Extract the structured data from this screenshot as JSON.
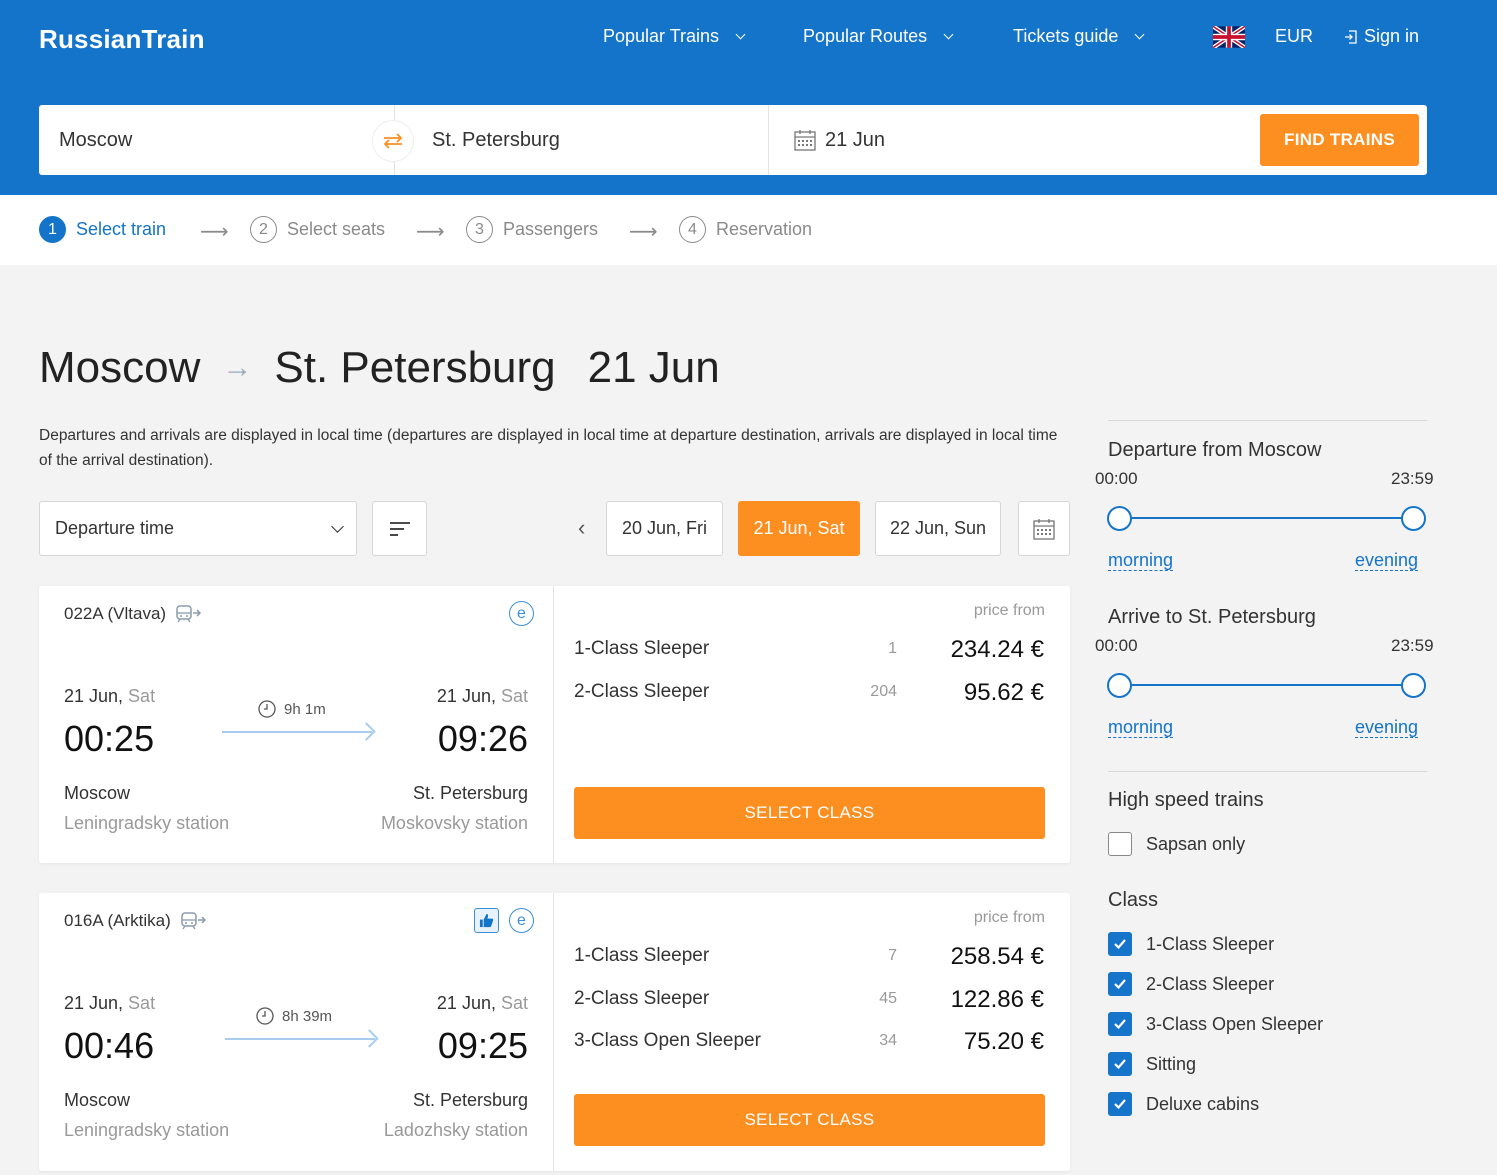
{
  "header": {
    "logo": "RussianTrain",
    "nav": [
      "Popular Trains",
      "Popular Routes",
      "Tickets guide"
    ],
    "currency": "EUR",
    "signin": "Sign in"
  },
  "search": {
    "from": "Moscow",
    "to": "St. Petersburg",
    "date": "21 Jun",
    "button": "FIND TRAINS"
  },
  "steps": [
    {
      "num": "1",
      "label": "Select train"
    },
    {
      "num": "2",
      "label": "Select seats"
    },
    {
      "num": "3",
      "label": "Passengers"
    },
    {
      "num": "4",
      "label": "Reservation"
    }
  ],
  "title": {
    "from": "Moscow",
    "to": "St. Petersburg",
    "date": "21 Jun"
  },
  "notice": "Departures and arrivals are displayed in local time (departures are displayed in local time at departure destination, arrivals are displayed in local time of the arrival destination).",
  "sort": {
    "label": "Departure time"
  },
  "dates": [
    "20 Jun, Fri",
    "21 Jun, Sat",
    "22 Jun, Sun"
  ],
  "trains": [
    {
      "name": "022A (Vltava)",
      "dep_date": "21 Jun,",
      "dep_wd": " Sat",
      "dep_time": "00:25",
      "arr_date": "21 Jun,",
      "arr_wd": " Sat",
      "arr_time": "09:26",
      "duration": "9h 1m",
      "from_city": "Moscow",
      "from_station": "Leningradsky station",
      "to_city": "St. Petersburg",
      "to_station": "Moskovsky station",
      "price_from": "price from",
      "classes": [
        {
          "name": "1-Class Sleeper",
          "seats": "1",
          "price": "234.24 €"
        },
        {
          "name": "2-Class Sleeper",
          "seats": "204",
          "price": "95.62 €"
        }
      ],
      "button": "SELECT CLASS"
    },
    {
      "name": "016A (Arktika)",
      "dep_date": "21 Jun,",
      "dep_wd": " Sat",
      "dep_time": "00:46",
      "arr_date": "21 Jun,",
      "arr_wd": " Sat",
      "arr_time": "09:25",
      "duration": "8h 39m",
      "from_city": "Moscow",
      "from_station": "Leningradsky station",
      "to_city": "St. Petersburg",
      "to_station": "Ladozhsky station",
      "price_from": "price from",
      "classes": [
        {
          "name": "1-Class Sleeper",
          "seats": "7",
          "price": "258.54 €"
        },
        {
          "name": "2-Class Sleeper",
          "seats": "45",
          "price": "122.86 €"
        },
        {
          "name": "3-Class Open Sleeper",
          "seats": "34",
          "price": "75.20 €"
        }
      ],
      "button": "SELECT CLASS"
    }
  ],
  "filters": {
    "departure": {
      "title": "Departure from Moscow",
      "min": "00:00",
      "max": "23:59",
      "morning": "morning",
      "evening": "evening"
    },
    "arrival": {
      "title": "Arrive to St. Petersburg",
      "min": "00:00",
      "max": "23:59",
      "morning": "morning",
      "evening": "evening"
    },
    "highspeed": {
      "title": "High speed trains",
      "option": "Sapsan only"
    },
    "class": {
      "title": "Class",
      "options": [
        "1-Class Sleeper",
        "2-Class Sleeper",
        "3-Class Open Sleeper",
        "Sitting",
        "Deluxe cabins"
      ]
    }
  },
  "colors": {
    "brand": "#1474c9",
    "accent": "#fd8f21"
  }
}
